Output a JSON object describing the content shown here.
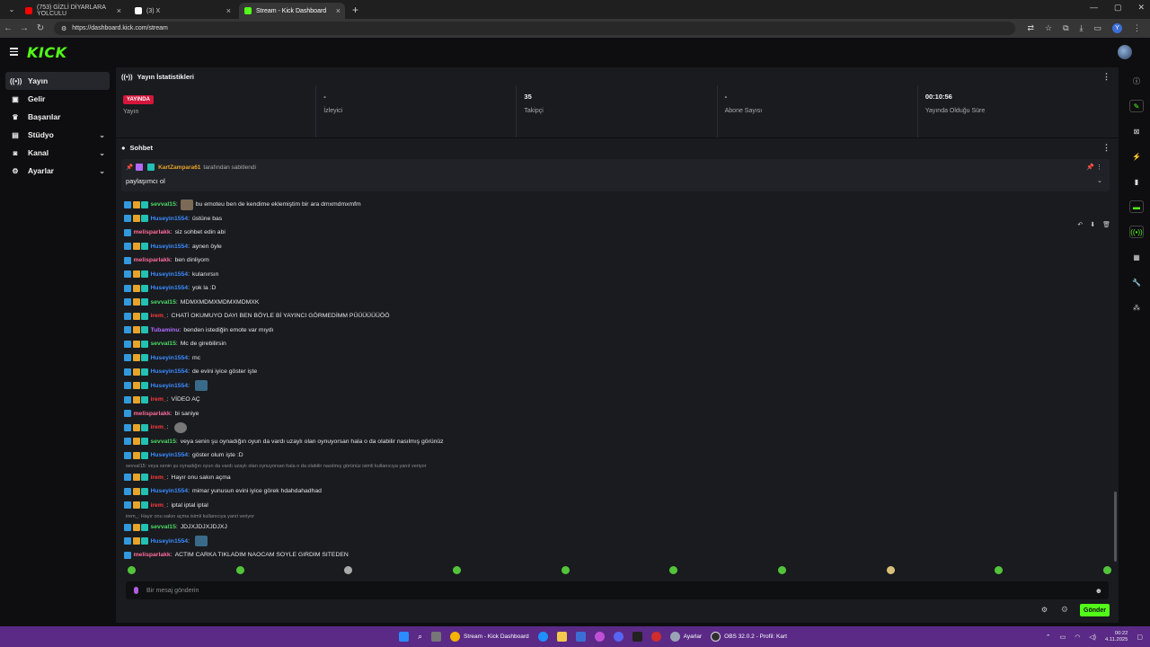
{
  "browser": {
    "tabs": [
      {
        "label": "(753) GİZLİ DİYARLARA YOLCULU",
        "icon": "youtube-icon",
        "active": false
      },
      {
        "label": "(3) X",
        "icon": "x-icon",
        "active": false
      },
      {
        "label": "Stream - Kick Dashboard",
        "icon": "kick-icon",
        "active": true
      }
    ],
    "url": "https://dashboard.kick.com/stream"
  },
  "header": {
    "logo": "KICK"
  },
  "sidebar": {
    "items": [
      {
        "label": "Yayın",
        "icon": "broadcast-icon",
        "active": true
      },
      {
        "label": "Gelir",
        "icon": "revenue-icon"
      },
      {
        "label": "Başarılar",
        "icon": "trophy-icon"
      },
      {
        "label": "Stüdyo",
        "icon": "studio-icon",
        "expandable": true
      },
      {
        "label": "Kanal",
        "icon": "channel-icon",
        "expandable": true
      },
      {
        "label": "Ayarlar",
        "icon": "settings-icon",
        "expandable": true
      }
    ]
  },
  "stats": {
    "title": "Yayın İstatistikleri",
    "live_badge": "YAYINDA",
    "items": [
      {
        "value": "",
        "label": "Yayın"
      },
      {
        "value": "-",
        "label": "İzleyici"
      },
      {
        "value": "35",
        "label": "Takipçi"
      },
      {
        "value": "-",
        "label": "Abone Sayısı"
      },
      {
        "value": "00:10:56",
        "label": "Yayında Olduğu Süre"
      }
    ]
  },
  "chat": {
    "title": "Sohbet",
    "pinned": {
      "user": "KartZampara61",
      "by_text": "tarafından sabitlendi",
      "message": "paylaşımcı ol"
    },
    "messages": [
      {
        "user": "sevval15",
        "color": "#4cd964",
        "badges": 3,
        "text": "bu emoteu ben de kendime eklemiştim bir ara dmxmdmxmfm",
        "emote_before": "e2"
      },
      {
        "user": "Huseyin1554",
        "color": "#3b8cff",
        "badges": 3,
        "text": "üstüne bas"
      },
      {
        "user": "melisparlakk",
        "color": "#ff6b9a",
        "badges": 1,
        "text": "siz sohbet edin abi"
      },
      {
        "user": "Huseyin1554",
        "color": "#3b8cff",
        "badges": 3,
        "text": "aynen öyle"
      },
      {
        "user": "melisparlakk",
        "color": "#ff6b9a",
        "badges": 1,
        "text": "ben dinliyom"
      },
      {
        "user": "Huseyin1554",
        "color": "#3b8cff",
        "badges": 3,
        "text": "kulanırsın"
      },
      {
        "user": "Huseyin1554",
        "color": "#3b8cff",
        "badges": 3,
        "text": "yok la :D"
      },
      {
        "user": "sevval15",
        "color": "#4cd964",
        "badges": 3,
        "text": "MDMXMDMXMDMXMDMXK"
      },
      {
        "user": "irem_",
        "color": "#ff3b3b",
        "badges": 3,
        "text": "CHATİ OKUMUYO DAYI BEN BÖYLE Bİ YAYINCI GÖRMEDİMM PÜÜÜÜÜÜÖÖ"
      },
      {
        "user": "Tubaminu",
        "color": "#b36bff",
        "badges": 3,
        "text": "benden istediğin emote var mıydı"
      },
      {
        "user": "sevval15",
        "color": "#4cd964",
        "badges": 3,
        "text": "Mc de girebilirsin"
      },
      {
        "user": "Huseyin1554",
        "color": "#3b8cff",
        "badges": 3,
        "text": "mc"
      },
      {
        "user": "Huseyin1554",
        "color": "#3b8cff",
        "badges": 3,
        "text": "de evini iyice göster işte"
      },
      {
        "user": "Huseyin1554",
        "color": "#3b8cff",
        "badges": 3,
        "text": "",
        "emote_after": "e1"
      },
      {
        "user": "irem_",
        "color": "#ff3b3b",
        "badges": 3,
        "text": "VİDEO AÇ"
      },
      {
        "user": "melisparlakk",
        "color": "#ff6b9a",
        "badges": 1,
        "text": "bi saniye"
      },
      {
        "user": "irem_",
        "color": "#ff3b3b",
        "badges": 3,
        "text": "",
        "emote_after": "e3"
      },
      {
        "user": "sevval15",
        "color": "#4cd964",
        "badges": 3,
        "text": "veya senin şu oynadığın oyun da vardı uzaylı olan oynuyorsan hala o da olabilir nasılmış görünüz"
      },
      {
        "user": "Huseyin1554",
        "color": "#3b8cff",
        "badges": 3,
        "text": "göster olum işte :D"
      },
      {
        "reply": "sevval15: veya senin şu oynadığın oyun da vardı uzaylı olan oynuyorsan hala o da olabilir nasılmış görünüz isimli kullanıcıya yanıt veriyor"
      },
      {
        "user": "irem_",
        "color": "#ff3b3b",
        "badges": 3,
        "text": "Hayır onu sakın açma"
      },
      {
        "user": "Huseyin1554",
        "color": "#3b8cff",
        "badges": 3,
        "text": "mimar yunusun evini iyice görek hdahdahadhad"
      },
      {
        "user": "irem_",
        "color": "#ff3b3b",
        "badges": 3,
        "text": "iptal iptal iptal"
      },
      {
        "reply": "irem_: Hayır onu sakın açma isimli kullanıcıya yanıt veriyor"
      },
      {
        "user": "sevval15",
        "color": "#4cd964",
        "badges": 3,
        "text": "JDJXJDJXJDJXJ"
      },
      {
        "user": "Huseyin1554",
        "color": "#3b8cff",
        "badges": 3,
        "text": "",
        "emote_after": "e1"
      },
      {
        "user": "melisparlakk",
        "color": "#ff6b9a",
        "badges": 1,
        "text": "ACTIM CARKA TIKLADIM NAOCAM SOYLE GIRDIM SITEDEN"
      }
    ],
    "input_placeholder": "Bir mesaj gönderin",
    "send_label": "Gönder"
  },
  "taskbar": {
    "apps": [
      {
        "label": "Stream - Kick Dashboard",
        "icon": "chrome-icon"
      },
      {
        "label": "Ayarlar",
        "icon": "settings-icon"
      },
      {
        "label": "OBS 32.0.2 - Profil: Kart",
        "icon": "obs-icon"
      }
    ],
    "time": "00:22",
    "date": "4.11.2025"
  },
  "colors": {
    "accent": "#53fc18",
    "live": "#d4163b",
    "taskbar": "#5a2a86"
  }
}
